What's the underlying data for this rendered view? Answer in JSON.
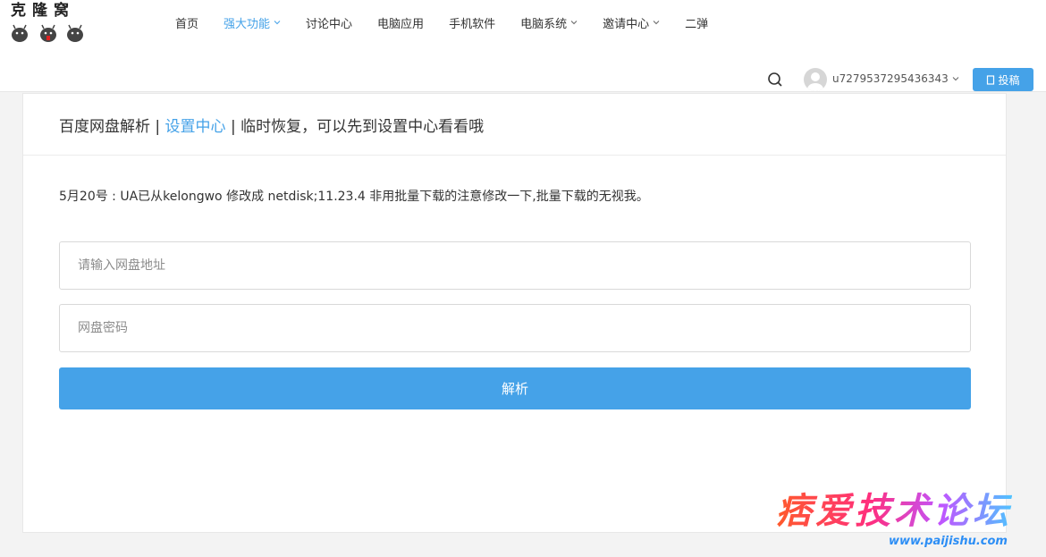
{
  "header": {
    "logo_text": "克隆窝",
    "nav": [
      {
        "label": "首页",
        "has_dropdown": false,
        "active": false
      },
      {
        "label": "强大功能",
        "has_dropdown": true,
        "active": true
      },
      {
        "label": "讨论中心",
        "has_dropdown": false,
        "active": false
      },
      {
        "label": "电脑应用",
        "has_dropdown": false,
        "active": false
      },
      {
        "label": "手机软件",
        "has_dropdown": false,
        "active": false
      },
      {
        "label": "电脑系统",
        "has_dropdown": true,
        "active": false
      },
      {
        "label": "邀请中心",
        "has_dropdown": true,
        "active": false
      },
      {
        "label": "二弹",
        "has_dropdown": false,
        "active": false
      }
    ],
    "username": "u7279537295436343",
    "post_button": "投稿",
    "accent_color": "#45a2e8"
  },
  "card": {
    "title_prefix": "百度网盘解析 | ",
    "title_link": "设置中心",
    "title_suffix": " | 临时恢复，可以先到设置中心看看哦",
    "notice": "5月20号 : UA已从kelongwo 修改成 netdisk;11.23.4 非用批量下载的注意修改一下,批量下载的无视我。",
    "url_placeholder": "请输入网盘地址",
    "password_placeholder": "网盘密码",
    "submit_label": "解析"
  },
  "watermark": {
    "title": "痞爱技术论坛",
    "url": "www.paijishu.com"
  }
}
